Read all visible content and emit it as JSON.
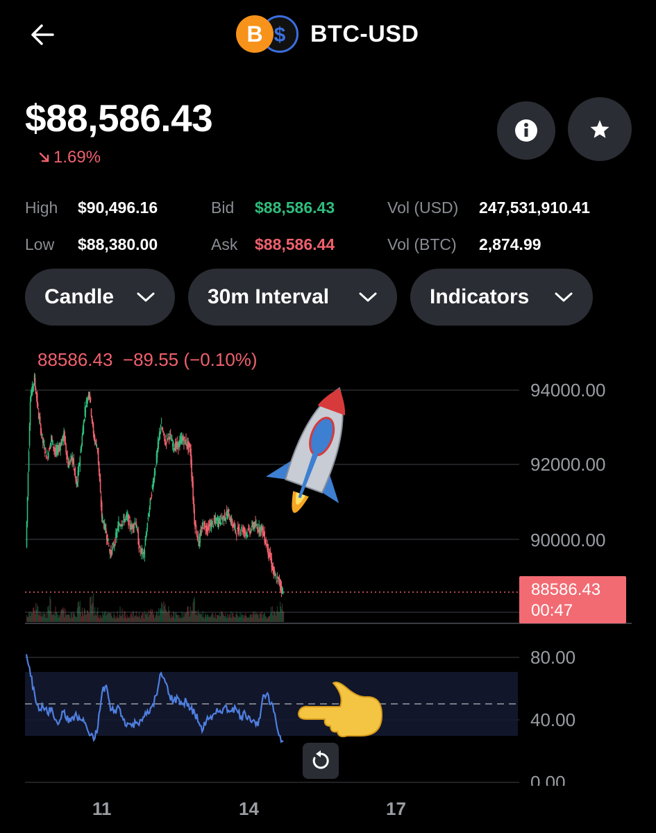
{
  "header": {
    "pair": "BTC-USD",
    "back_icon": "back-arrow-icon",
    "coin_icon_1": "bitcoin-icon",
    "coin_icon_2": "dollar-icon"
  },
  "price": {
    "value": "$88,586.43",
    "change": "1.69%",
    "change_direction": "down",
    "change_color": "#f0616d"
  },
  "buttons": {
    "info_icon": "info-icon",
    "favorite_icon": "star-icon"
  },
  "stats": {
    "high_label": "High",
    "high_value": "$90,496.16",
    "low_label": "Low",
    "low_value": "$88,380.00",
    "bid_label": "Bid",
    "bid_value": "$88,586.43",
    "ask_label": "Ask",
    "ask_value": "$88,586.44",
    "vol_usd_label": "Vol (USD)",
    "vol_usd_value": "247,531,910.41",
    "vol_btc_label": "Vol (BTC)",
    "vol_btc_value": "2,874.99"
  },
  "controls": {
    "chart_type": "Candle",
    "interval": "30m Interval",
    "indicators": "Indicators"
  },
  "chart": {
    "ohlc_readout": "88586.43  −89.55 (−0.10%)",
    "price_axis": [
      "94000.00",
      "92000.00",
      "90000.00"
    ],
    "last_price": "88586.43",
    "countdown": "00:47",
    "rsi_axis": [
      "80.00",
      "40.00",
      "0.00"
    ],
    "date_axis": [
      "11",
      "14",
      "17"
    ],
    "up_color": "#2fbd7d",
    "down_color": "#f0616d",
    "rsi_color": "#4f7fe0",
    "decor": [
      "rocket-emoji",
      "pointing-hand-emoji"
    ]
  },
  "chart_data": {
    "type": "candlestick",
    "price_ylim": [
      88000,
      95000
    ],
    "price_path": [
      [
        0,
        89800
      ],
      [
        1,
        93800
      ],
      [
        2,
        94300
      ],
      [
        3,
        93300
      ],
      [
        4,
        92600
      ],
      [
        5,
        92200
      ],
      [
        6,
        92700
      ],
      [
        7,
        92300
      ],
      [
        8,
        92500
      ],
      [
        9,
        92800
      ],
      [
        10,
        92000
      ],
      [
        11,
        92200
      ],
      [
        12,
        91400
      ],
      [
        13,
        92400
      ],
      [
        14,
        93500
      ],
      [
        15,
        94000
      ],
      [
        16,
        92800
      ],
      [
        17,
        92400
      ],
      [
        18,
        90600
      ],
      [
        19,
        90200
      ],
      [
        20,
        89600
      ],
      [
        21,
        89900
      ],
      [
        22,
        90400
      ],
      [
        23,
        90500
      ],
      [
        24,
        90600
      ],
      [
        25,
        90300
      ],
      [
        26,
        90500
      ],
      [
        27,
        89700
      ],
      [
        28,
        89600
      ],
      [
        29,
        90600
      ],
      [
        30,
        91400
      ],
      [
        31,
        92200
      ],
      [
        32,
        93100
      ],
      [
        33,
        92600
      ],
      [
        34,
        92800
      ],
      [
        35,
        92500
      ],
      [
        36,
        92500
      ],
      [
        37,
        92700
      ],
      [
        38,
        92600
      ],
      [
        39,
        92400
      ],
      [
        40,
        90500
      ],
      [
        41,
        89900
      ],
      [
        42,
        90400
      ],
      [
        43,
        90300
      ],
      [
        44,
        90400
      ],
      [
        45,
        90500
      ],
      [
        46,
        90500
      ],
      [
        47,
        90600
      ],
      [
        48,
        90700
      ],
      [
        49,
        90400
      ],
      [
        50,
        90200
      ],
      [
        51,
        90300
      ],
      [
        52,
        90200
      ],
      [
        53,
        90200
      ],
      [
        54,
        90400
      ],
      [
        55,
        90300
      ],
      [
        56,
        90300
      ],
      [
        57,
        89900
      ],
      [
        58,
        89500
      ],
      [
        59,
        89000
      ],
      [
        60,
        88900
      ],
      [
        61,
        88600
      ]
    ],
    "volume": [
      2,
      3,
      4,
      2,
      2,
      5,
      3,
      2,
      3,
      3,
      2,
      2,
      4,
      3,
      3,
      6,
      3,
      2,
      3,
      2,
      2,
      2,
      3,
      2,
      2,
      2,
      2,
      2,
      2,
      3,
      2,
      3,
      4,
      3,
      2,
      2,
      2,
      2,
      3,
      5,
      3,
      2,
      2,
      2,
      2,
      2,
      2,
      2,
      2,
      2,
      2,
      2,
      2,
      2,
      2,
      2,
      2,
      2,
      3,
      3,
      4,
      2
    ],
    "rsi_ylim": [
      0,
      100
    ],
    "rsi": [
      82,
      68,
      56,
      46,
      48,
      44,
      48,
      40,
      40,
      46,
      38,
      42,
      42,
      40,
      38,
      30,
      27,
      36,
      58,
      62,
      46,
      46,
      48,
      40,
      38,
      36,
      38,
      40,
      42,
      44,
      50,
      56,
      70,
      64,
      56,
      52,
      54,
      50,
      52,
      47,
      44,
      38,
      34,
      42,
      40,
      44,
      46,
      48,
      46,
      48,
      46,
      42,
      44,
      42,
      40,
      36,
      52,
      56,
      50,
      44,
      30,
      26
    ],
    "rsi_overbought": 70,
    "rsi_oversold": 30,
    "rsi_midline": 50,
    "x_ticks": [
      "11",
      "14",
      "17"
    ]
  }
}
